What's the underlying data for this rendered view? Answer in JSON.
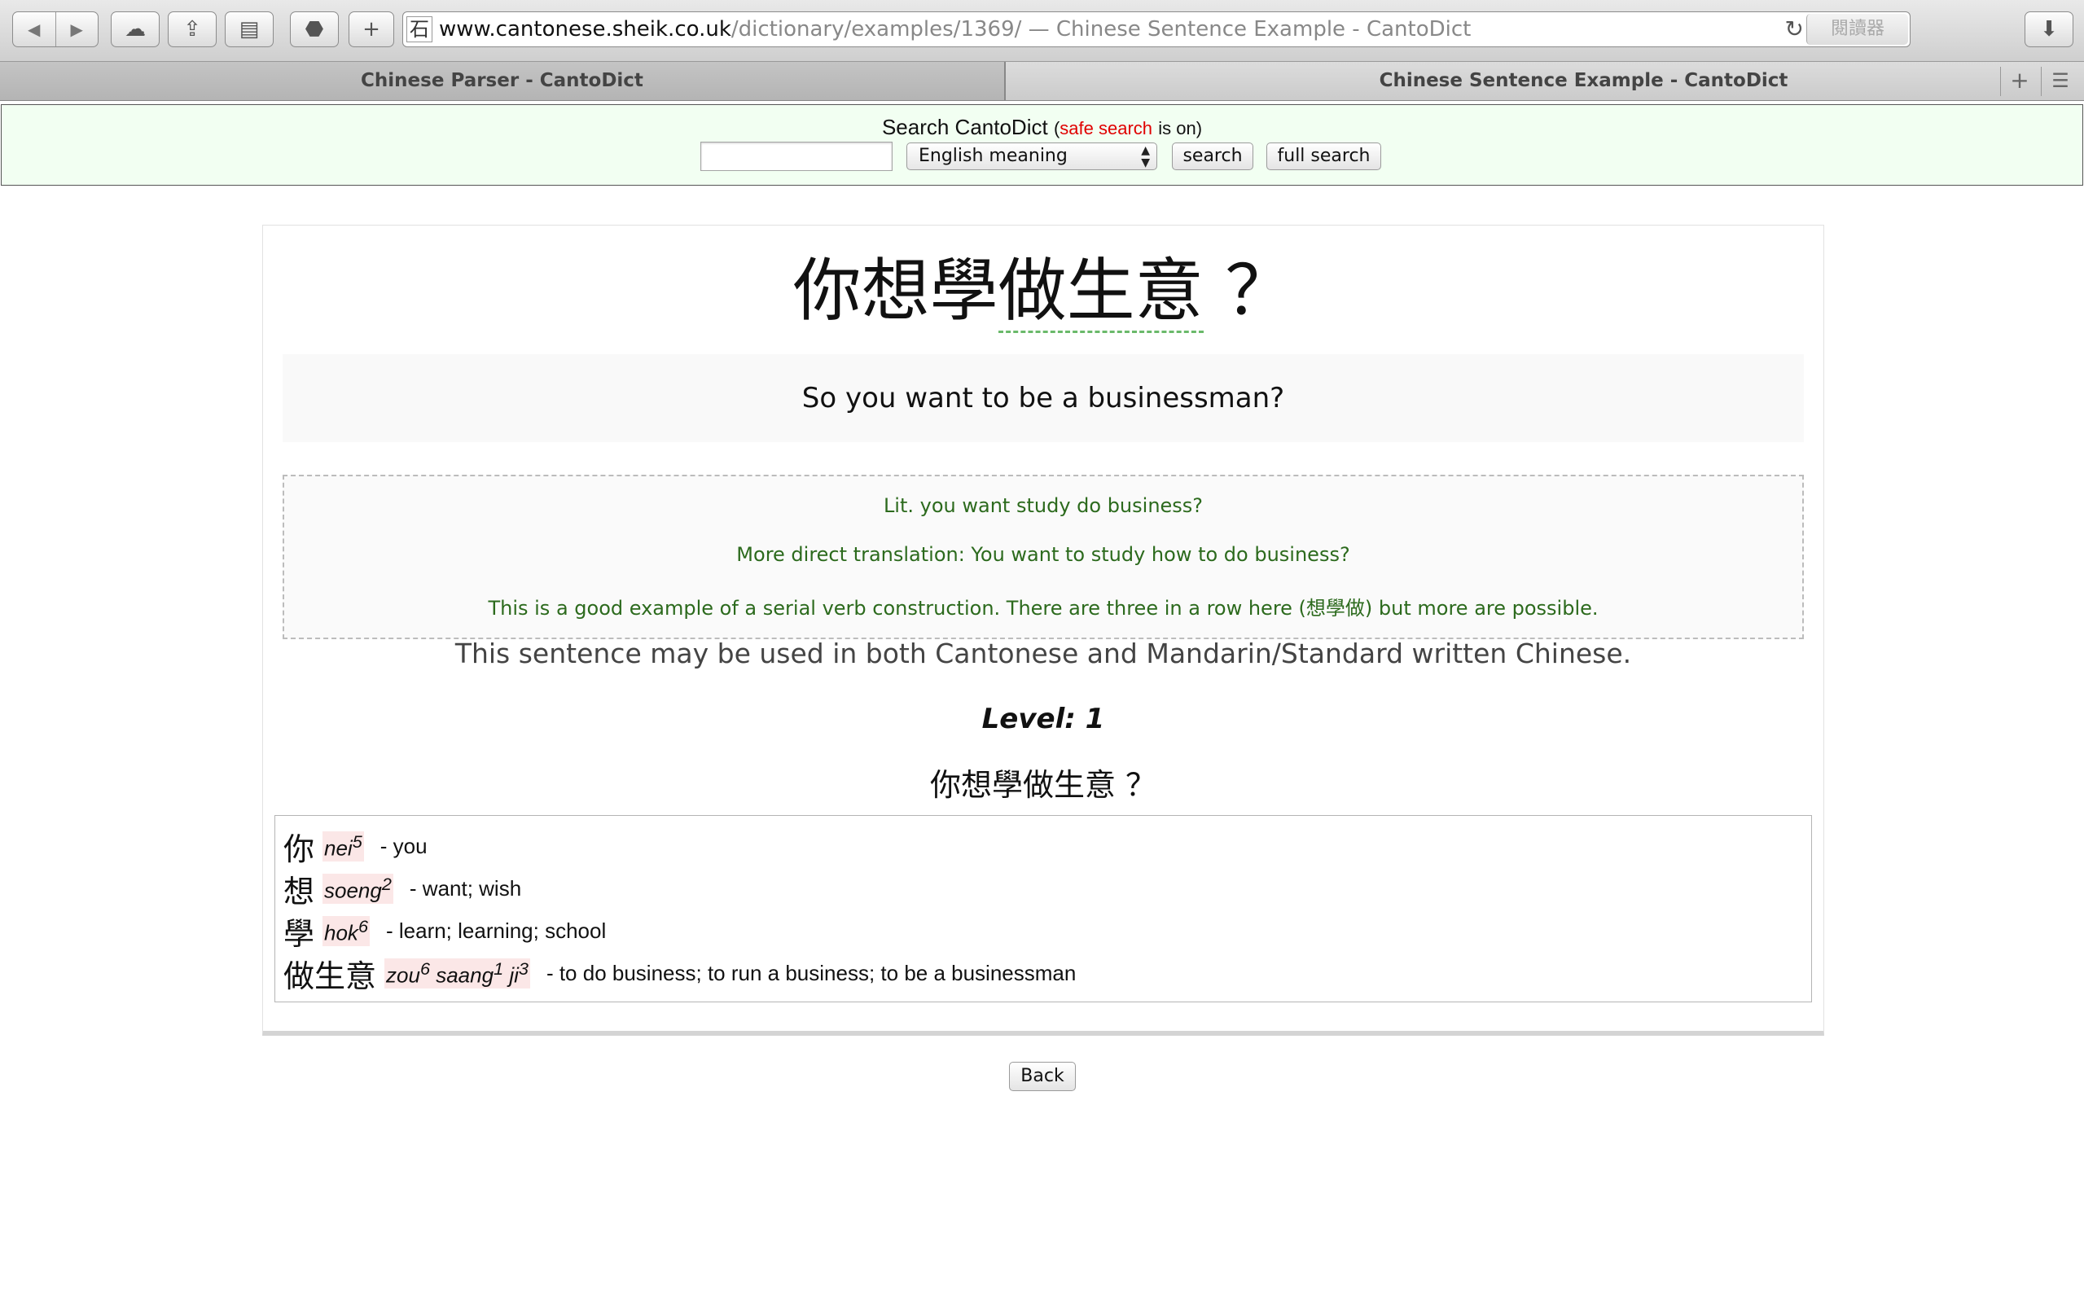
{
  "browser": {
    "url_host": "www.cantonese.sheik.co.uk",
    "url_path": "/dictionary/examples/1369/",
    "url_title": " — Chinese Sentence Example - CantoDict",
    "reader_label": "閱讀器",
    "tabs": [
      {
        "label": "Chinese Parser - CantoDict"
      },
      {
        "label": "Chinese Sentence Example - CantoDict"
      }
    ]
  },
  "search": {
    "heading": "Search CantoDict",
    "safe_search": "safe search",
    "is_on": "is on)",
    "open_paren": "(",
    "input_value": "",
    "select_value": "English meaning",
    "search_label": "search",
    "full_search_label": "full search"
  },
  "example": {
    "sentence_lead": "你想學",
    "sentence_biz": "做生意",
    "sentence_tail": " ？",
    "translation": "So you want to be a businessman?",
    "notes": [
      "Lit. you want study do business?",
      "More direct translation: You want to study how to do business?",
      "This is a good example of a serial verb construction. There are three in a row here (想學做) but more are possible."
    ],
    "usage": "This sentence may be used in both Cantonese and Mandarin/Standard written Chinese.",
    "level": "Level: 1",
    "sentence_small": "你想學做生意 ？",
    "words": [
      {
        "chars": "你",
        "jyut": [
          {
            "s": "nei",
            "t": "5"
          }
        ],
        "def": "- you"
      },
      {
        "chars": "想",
        "jyut": [
          {
            "s": "soeng",
            "t": "2"
          }
        ],
        "def": "- want; wish"
      },
      {
        "chars": "學",
        "jyut": [
          {
            "s": "hok",
            "t": "6"
          }
        ],
        "def": "- learn; learning; school"
      },
      {
        "chars": "做生意",
        "jyut": [
          {
            "s": "zou",
            "t": "6"
          },
          {
            "s": "saang",
            "t": "1"
          },
          {
            "s": "ji",
            "t": "3"
          }
        ],
        "def": "-  to do business; to run a business; to be a businessman"
      }
    ]
  },
  "back_label": "Back",
  "colors": {
    "search_bg": "#f2fff2",
    "safe_search": "#e00000",
    "note_text": "#2c6a1d",
    "jyutping_bg": "#fbe7e7"
  }
}
